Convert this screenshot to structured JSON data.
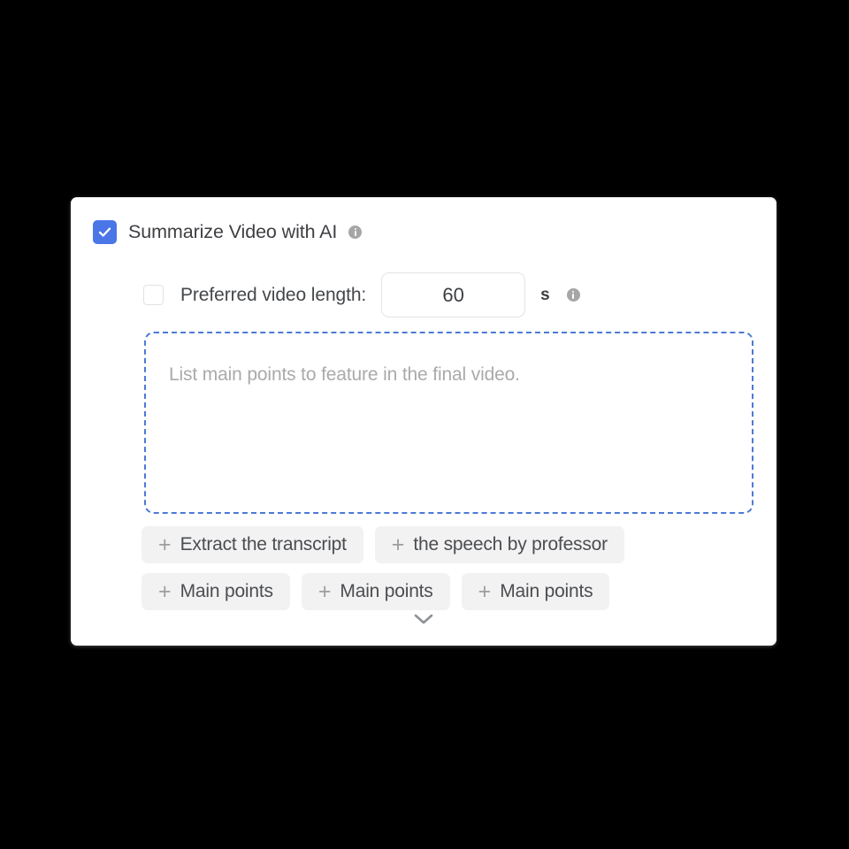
{
  "card": {
    "master_option": {
      "label": "Summarize Video with AI",
      "checked": true,
      "info_icon": "info-icon"
    },
    "preferred_length": {
      "label": "Preferred video length:",
      "checked": false,
      "value": "60",
      "unit": "s",
      "info_icon": "info-icon"
    },
    "prompt_area": {
      "placeholder": "List main points to feature in the final video.",
      "value": "",
      "border_color": "#4b7ad6"
    },
    "suggestion_chips": [
      [
        {
          "plus": "+",
          "label": "Extract the transcript"
        },
        {
          "plus": "+",
          "label": "the speech by professor"
        }
      ],
      [
        {
          "plus": "+",
          "label": "Main points"
        },
        {
          "plus": "+",
          "label": "Main points"
        },
        {
          "plus": "+",
          "label": "Main points"
        }
      ]
    ],
    "expand_toggle": {
      "icon": "chevron-down-icon"
    },
    "colors": {
      "checkbox_accent": "#4a76e8",
      "dashed_border": "#4b7ad6",
      "chip_background": "#f2f2f3",
      "card_background": "#ffffff",
      "page_background": "#000000"
    }
  }
}
